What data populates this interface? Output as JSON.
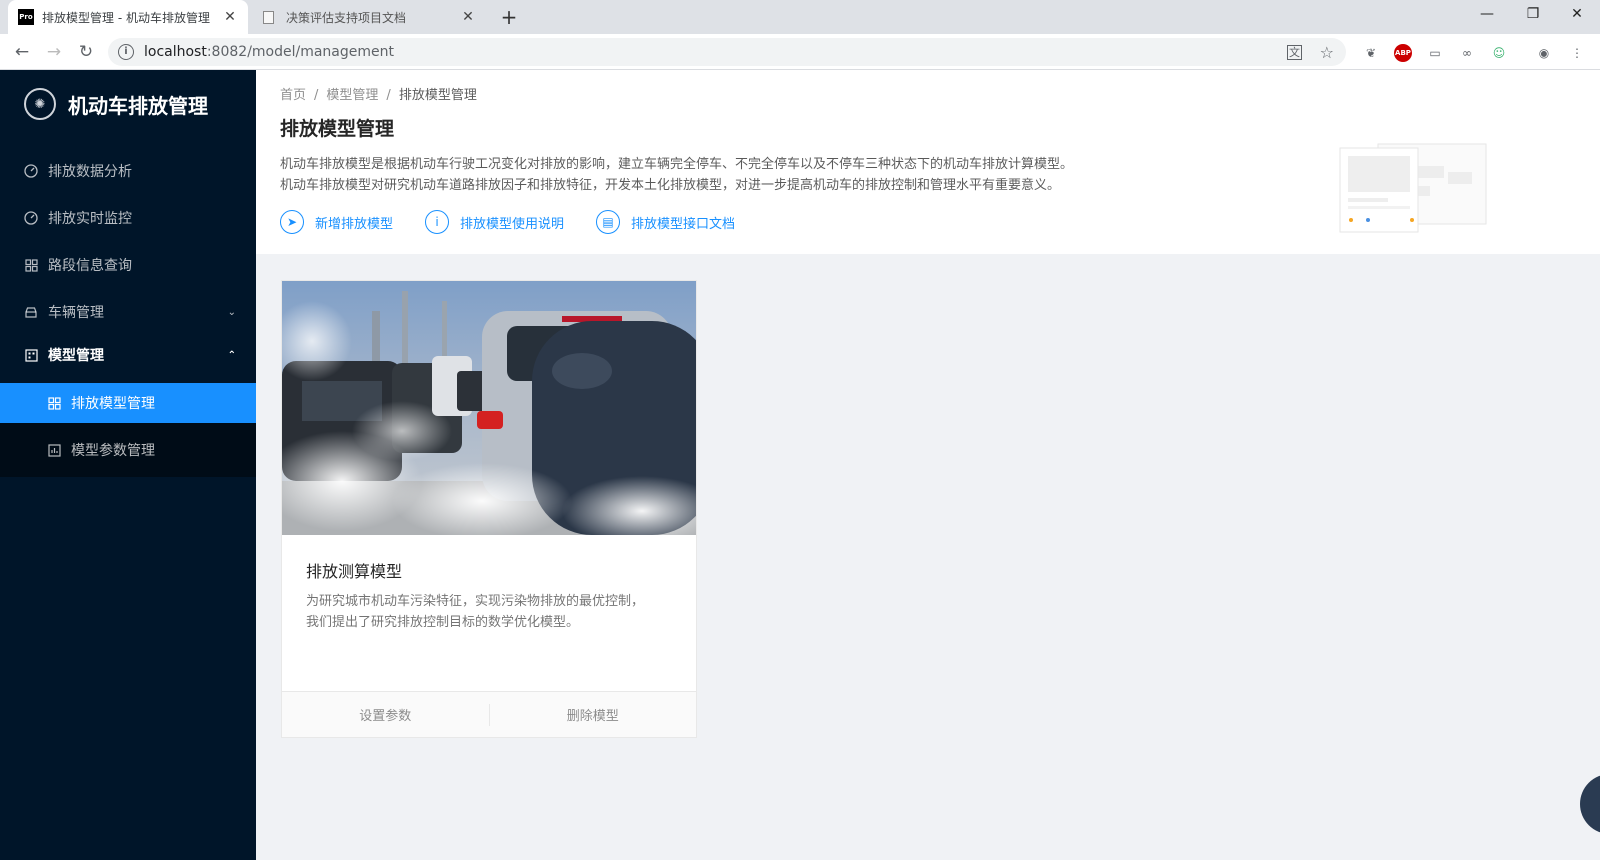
{
  "browser": {
    "tabs": [
      {
        "favicon_text": "Pro",
        "title": "排放模型管理 - 机动车排放管理",
        "active": true
      },
      {
        "title": "决策评估支持项目文档",
        "active": false
      }
    ],
    "url_host": "localhost",
    "url_rest": ":8082/model/management"
  },
  "sidebar": {
    "brand": "机动车排放管理",
    "items": [
      {
        "label": "排放数据分析",
        "icon": "dashboard-icon"
      },
      {
        "label": "排放实时监控",
        "icon": "dashboard-icon"
      },
      {
        "label": "路段信息查询",
        "icon": "appstore-icon"
      },
      {
        "label": "车辆管理",
        "icon": "car-icon",
        "expand": "collapsed"
      },
      {
        "label": "模型管理",
        "icon": "project-icon",
        "expand": "expanded"
      }
    ],
    "subitems": [
      {
        "label": "排放模型管理",
        "icon": "appstore-icon",
        "selected": true
      },
      {
        "label": "模型参数管理",
        "icon": "chart-icon",
        "selected": false
      }
    ]
  },
  "header": {
    "breadcrumb": [
      "首页",
      "模型管理",
      "排放模型管理"
    ],
    "title": "排放模型管理",
    "desc_lines": [
      "机动车排放模型是根据机动车行驶工况变化对排放的影响，建立车辆完全停车、不完全停车以及不停车三种状态下的机动车排放计算模型。",
      "机动车排放模型对研究机动车道路排放因子和排放特征，开发本土化排放模型，对进一步提高机动车的排放控制和管理水平有重要意义。"
    ],
    "links": [
      {
        "label": "新增排放模型",
        "icon": "send-icon"
      },
      {
        "label": "排放模型使用说明",
        "icon": "info-icon"
      },
      {
        "label": "排放模型接口文档",
        "icon": "file-icon"
      }
    ]
  },
  "card": {
    "title": "排放测算模型",
    "desc_lines": [
      "为研究城市机动车污染特征，实现污染物排放的最优控制，",
      "我们提出了研究排放控制目标的数学优化模型。"
    ],
    "actions": [
      "设置参数",
      "删除模型"
    ]
  },
  "colors": {
    "sidebar_bg": "#001529",
    "accent": "#1890ff",
    "page_bg": "#f0f2f5"
  }
}
